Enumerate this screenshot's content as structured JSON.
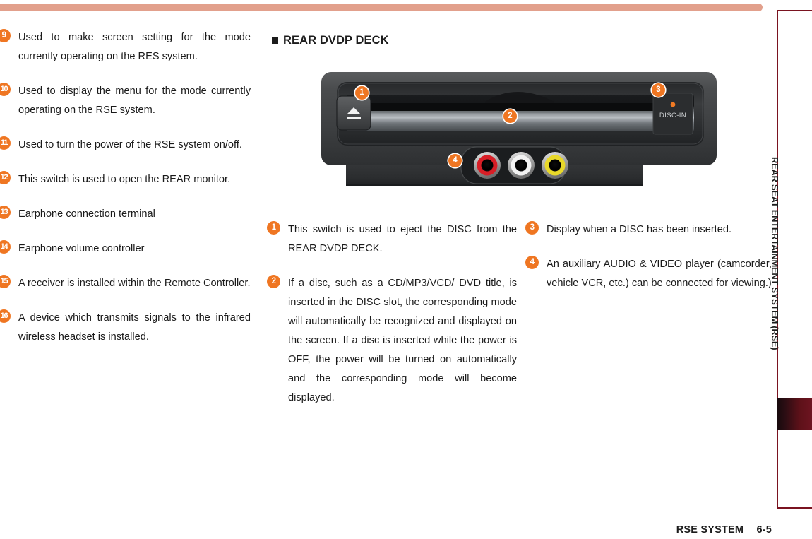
{
  "page": {
    "footer_section": "RSE SYSTEM",
    "footer_page": "6-5",
    "side_tab_label": "REAR SEAT ENTERTAINMENT SYSTEM (RSE)",
    "accent_orange": "#ef7622",
    "accent_salmon": "#e2a08c",
    "accent_maroon": "#7a1320"
  },
  "left_column": {
    "items": [
      {
        "num": "9",
        "text": "Used to make screen setting for the mode currently operating on the RES system."
      },
      {
        "num": "10",
        "text": "Used to display the menu for the mode currently operating on the RSE system."
      },
      {
        "num": "11",
        "text": "Used to turn the power of the RSE system on/off."
      },
      {
        "num": "12",
        "text": "This switch is used to open the REAR monitor."
      },
      {
        "num": "13",
        "text": "Earphone connection terminal"
      },
      {
        "num": "14",
        "text": "Earphone volume controller"
      },
      {
        "num": "15",
        "text": "A receiver is installed within the Remote Controller."
      },
      {
        "num": "16",
        "text": "A device which transmits signals to the infrared wireless headset is installed."
      }
    ]
  },
  "section": {
    "title": "REAR DVDP DECK",
    "bullet": "square-bullet"
  },
  "illustration": {
    "name": "rear-dvdp-deck",
    "disc_in_label": "DISC-IN",
    "eject_icon": "eject-icon",
    "callouts": [
      {
        "num": "1",
        "target": "eject-button"
      },
      {
        "num": "2",
        "target": "disc-slot"
      },
      {
        "num": "3",
        "target": "disc-in-indicator"
      },
      {
        "num": "4",
        "target": "av-input-jacks"
      }
    ],
    "jacks": [
      {
        "name": "audio-right-jack",
        "color": "#d81e26"
      },
      {
        "name": "audio-left-jack",
        "color": "#f2f2f2"
      },
      {
        "name": "video-jack",
        "color": "#e8d82a"
      }
    ]
  },
  "mid_column": {
    "items": [
      {
        "num": "1",
        "text": "This switch is used to eject the DISC from the REAR DVDP DECK."
      },
      {
        "num": "2",
        "text": "If a disc, such as a CD/MP3/VCD/ DVD title, is inserted in the DISC slot, the corresponding mode will automatically be recognized and displayed on the screen. If a disc is inserted while the power is OFF, the power will be turned on automatically and the corresponding mode will become displayed."
      }
    ]
  },
  "right_column": {
    "items": [
      {
        "num": "3",
        "text": "Display when a DISC has been inserted."
      },
      {
        "num": "4",
        "text": "An auxiliary AUDIO & VIDEO player (camcorder, vehicle VCR, etc.) can be connected for viewing.)"
      }
    ]
  }
}
